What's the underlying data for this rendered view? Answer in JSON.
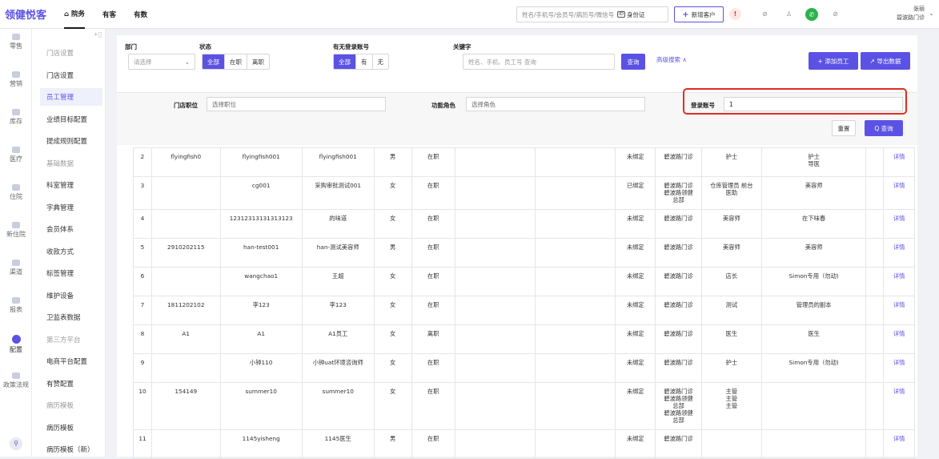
{
  "app": {
    "logo": "领健悦客"
  },
  "topnav": [
    {
      "label": "⌂ 院务",
      "active": true
    },
    {
      "label": "有客",
      "active": false
    },
    {
      "label": "有数",
      "active": false
    }
  ],
  "header": {
    "search_placeholder": "姓名/手机号/会员号/病历号/微信号",
    "id_card_label": "身份证",
    "add_customer_label": "新增客户",
    "user_name": "张丽",
    "user_clinic": "碧波路门诊"
  },
  "sidebar": [
    {
      "label": "零售"
    },
    {
      "label": "营销"
    },
    {
      "label": "库存"
    },
    {
      "label": "医疗"
    },
    {
      "label": "住院"
    },
    {
      "label": "新住院"
    },
    {
      "label": "渠道"
    },
    {
      "label": "报表"
    },
    {
      "label": "配置",
      "active": true
    },
    {
      "label": "政策法规"
    }
  ],
  "menu": [
    {
      "label": "门店设置",
      "type": "group"
    },
    {
      "label": "门店设置",
      "type": "item"
    },
    {
      "label": "员工管理",
      "type": "item",
      "active": true
    },
    {
      "label": "业绩目标配置",
      "type": "item"
    },
    {
      "label": "提成规则配置",
      "type": "item"
    },
    {
      "label": "基础数据",
      "type": "group"
    },
    {
      "label": "科室管理",
      "type": "item"
    },
    {
      "label": "字典管理",
      "type": "item"
    },
    {
      "label": "会员体系",
      "type": "item"
    },
    {
      "label": "收款方式",
      "type": "item"
    },
    {
      "label": "标签管理",
      "type": "item"
    },
    {
      "label": "维护设备",
      "type": "item"
    },
    {
      "label": "卫监表数据",
      "type": "item"
    },
    {
      "label": "第三方平台",
      "type": "group"
    },
    {
      "label": "电商平台配置",
      "type": "item"
    },
    {
      "label": "有赞配置",
      "type": "item"
    },
    {
      "label": "病历模板",
      "type": "group"
    },
    {
      "label": "病历模板",
      "type": "item"
    },
    {
      "label": "病历模板（新）",
      "type": "item"
    }
  ],
  "filters": {
    "dept_label": "部门",
    "dept_placeholder": "请选择",
    "status_label": "状态",
    "status_options": [
      "全部",
      "在职",
      "离职"
    ],
    "login_label": "有无登录账号",
    "login_options": [
      "全部",
      "有",
      "无"
    ],
    "keyword_label": "关键字",
    "keyword_placeholder": "姓名、手机、员工号 查询",
    "query_btn": "查询",
    "advanced": "高级搜索 ∧",
    "add_staff": "+ 添加员工",
    "export": "↗ 导出数据",
    "position_label": "门店职位",
    "position_placeholder": "选择职位",
    "role_label": "功能角色",
    "role_placeholder": "选择角色",
    "account_label": "登录账号",
    "account_value": "1",
    "reset_btn": "重置",
    "search_btn": "Q 查询"
  },
  "rows": [
    {
      "no": "2",
      "code": "flyingfish0",
      "account": "flyingfish001",
      "name": "flyingfish001",
      "sex": "男",
      "status": "在职",
      "bind": "未绑定",
      "clinics": [
        "碧波路门诊"
      ],
      "positions": [
        "护士"
      ],
      "roles": [
        "护士",
        "导医"
      ],
      "action": "详情"
    },
    {
      "no": "3",
      "code": "",
      "account": "cg001",
      "name": "采购审批测试001",
      "sex": "女",
      "status": "在职",
      "bind": "已绑定",
      "clinics": [
        "碧波路门诊",
        "碧波路领健",
        "总部"
      ],
      "positions": [
        "仓库管理员 前台",
        "医助"
      ],
      "roles": [
        "美容师"
      ],
      "action": "详情"
    },
    {
      "no": "4",
      "code": "",
      "account": "12312313131313123",
      "name": "的味道",
      "sex": "女",
      "status": "在职",
      "bind": "未绑定",
      "clinics": [
        "碧波路门诊"
      ],
      "positions": [
        "美容师"
      ],
      "roles": [
        "在下味春"
      ],
      "action": "详情"
    },
    {
      "no": "5",
      "code": "2910202115",
      "account": "han-test001",
      "name": "han-测试美容师",
      "sex": "男",
      "status": "在职",
      "bind": "未绑定",
      "clinics": [
        "碧波路门诊"
      ],
      "positions": [
        "美容师"
      ],
      "roles": [
        "美容师"
      ],
      "action": "详情"
    },
    {
      "no": "6",
      "code": "",
      "account": "wangchao1",
      "name": "王超",
      "sex": "女",
      "status": "在职",
      "bind": "未绑定",
      "clinics": [
        "碧波路门诊"
      ],
      "positions": [
        "店长"
      ],
      "roles": [
        "Simon专用（勿动)"
      ],
      "action": "详情"
    },
    {
      "no": "7",
      "code": "1811202102",
      "account": "李123",
      "name": "李123",
      "sex": "女",
      "status": "在职",
      "bind": "未绑定",
      "clinics": [
        "碧波路门诊"
      ],
      "positions": [
        "测试"
      ],
      "roles": [
        "管理员的副本"
      ],
      "action": "详情"
    },
    {
      "no": "8",
      "code": "A1",
      "account": "A1",
      "name": "A1员工",
      "sex": "女",
      "status": "离职",
      "bind": "未绑定",
      "clinics": [
        "碧波路门诊"
      ],
      "positions": [
        "医生"
      ],
      "roles": [
        "医生"
      ],
      "action": "详情"
    },
    {
      "no": "9",
      "code": "",
      "account": "小钟110",
      "name": "小钟uat环境咨询师",
      "sex": "女",
      "status": "在职",
      "bind": "未绑定",
      "clinics": [
        "碧波路门诊"
      ],
      "positions": [
        "护士"
      ],
      "roles": [
        "Simon专用（勿动)"
      ],
      "action": "详情"
    },
    {
      "no": "10",
      "code": "154149",
      "account": "summer10",
      "name": "summer10",
      "sex": "女",
      "status": "在职",
      "bind": "未绑定",
      "clinics": [
        "碧波路门诊",
        "碧波路领健",
        "总部",
        "碧波路领健",
        "总部"
      ],
      "positions": [
        "主管",
        "主管",
        "",
        "主管"
      ],
      "roles": [],
      "action": "详情"
    },
    {
      "no": "11",
      "code": "",
      "account": "1145yisheng",
      "name": "1145医生",
      "sex": "男",
      "status": "在职",
      "bind": "未绑定",
      "clinics": [
        "碧波路门诊"
      ],
      "positions": [],
      "roles": [],
      "action": "详情"
    }
  ]
}
